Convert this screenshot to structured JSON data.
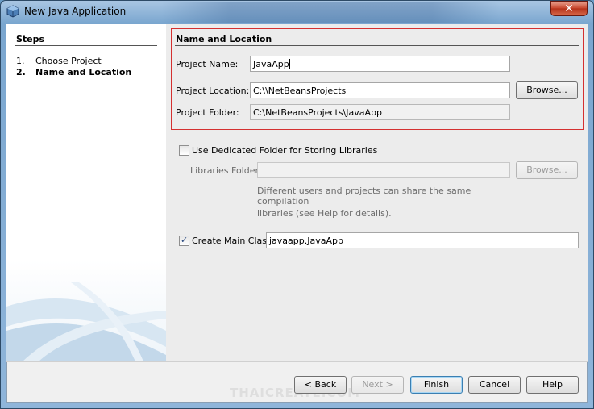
{
  "window": {
    "title": "New Java Application",
    "close_glyph": "✕"
  },
  "steps": {
    "title": "Steps",
    "items": [
      {
        "num": "1.",
        "label": "Choose Project"
      },
      {
        "num": "2.",
        "label": "Name and Location"
      }
    ]
  },
  "section": {
    "title": "Name and Location"
  },
  "project_name": {
    "label": "Project Name:",
    "value": "JavaApp"
  },
  "project_location": {
    "label": "Project Location:",
    "value": "C:\\\\NetBeansProjects",
    "browse": "Browse..."
  },
  "project_folder": {
    "label": "Project Folder:",
    "value": "C:\\NetBeansProjects\\JavaApp"
  },
  "libraries": {
    "checkbox_label": "Use Dedicated Folder for Storing Libraries",
    "checked": false,
    "folder_label": "Libraries Folder:",
    "folder_value": "",
    "browse": "Browse...",
    "help_line1": "Different users and projects can share the same compilation",
    "help_line2": "libraries (see Help for details)."
  },
  "main_class": {
    "checkbox_label": "Create Main Class",
    "checked": true,
    "value": "javaapp.JavaApp"
  },
  "buttons": {
    "back": "< Back",
    "next": "Next >",
    "finish": "Finish",
    "cancel": "Cancel",
    "help": "Help"
  },
  "watermark": "THAICREATE.COM",
  "colors": {
    "highlight_border": "#d43030",
    "window_frame": "#7aa6cf"
  }
}
